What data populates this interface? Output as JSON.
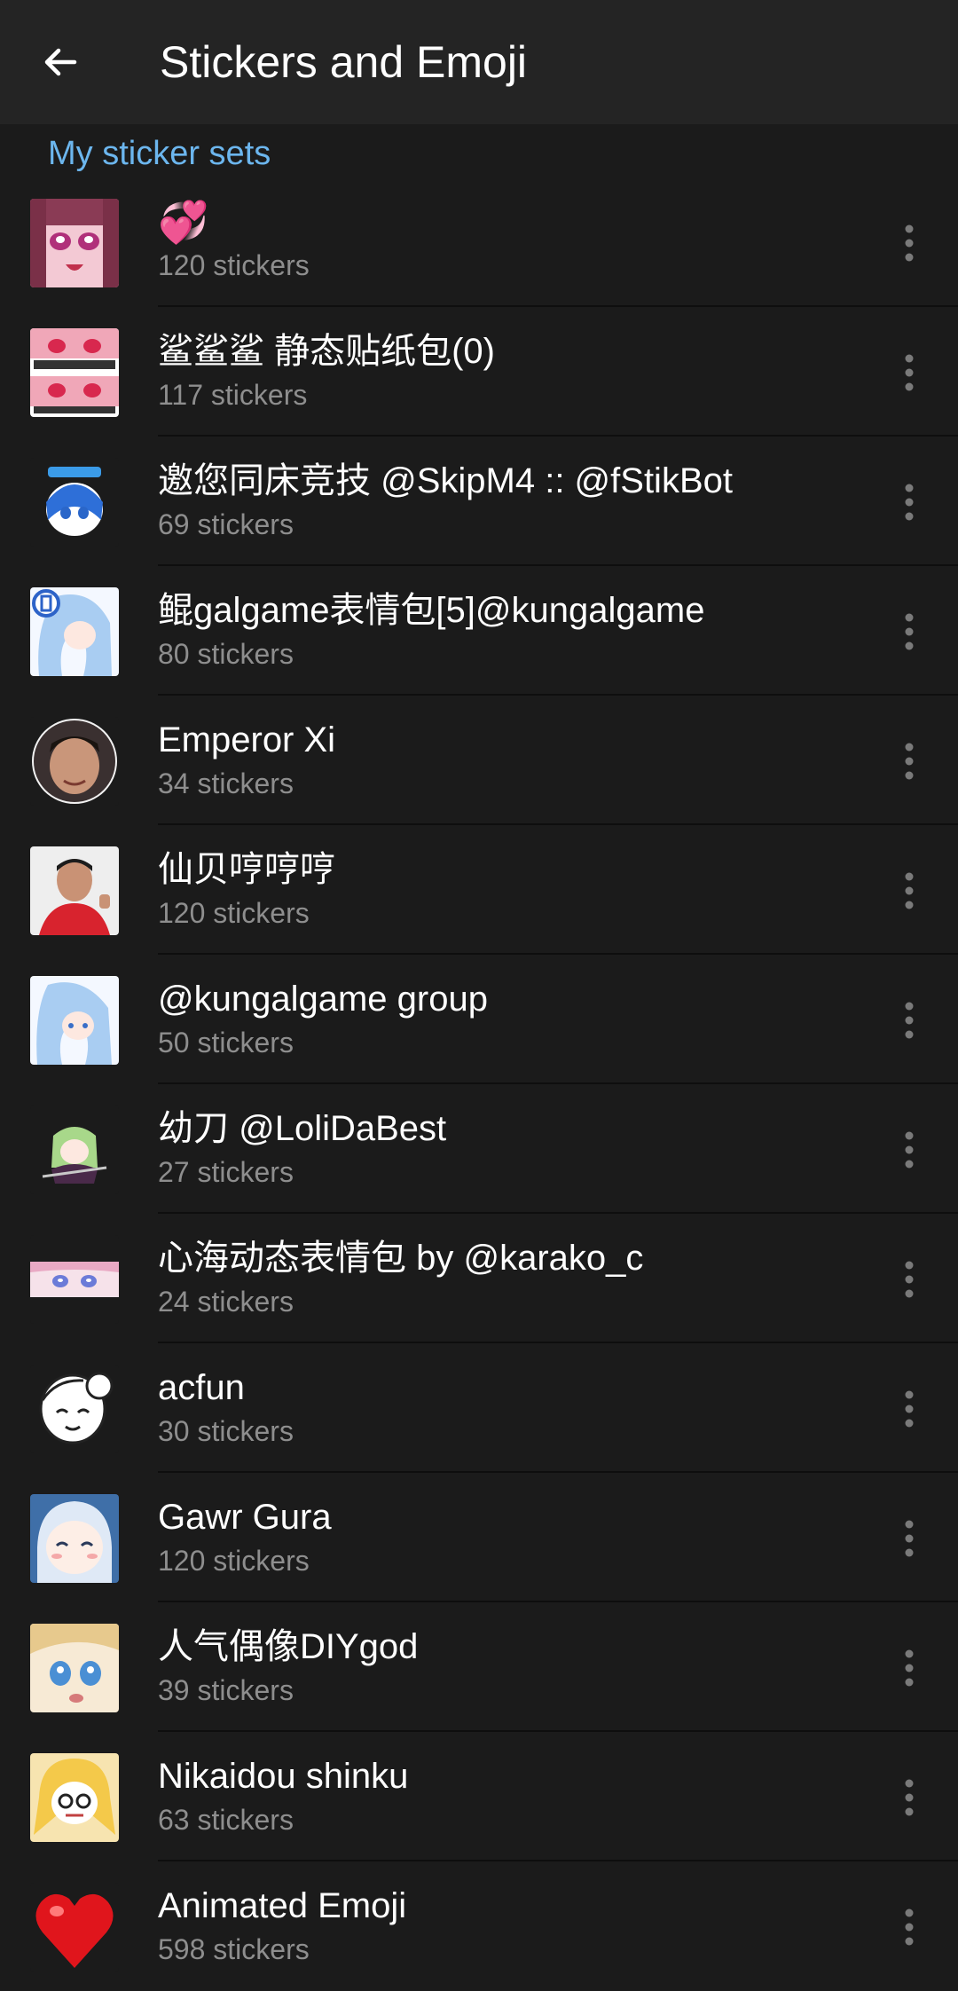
{
  "header": {
    "title": "Stickers and Emoji",
    "back_icon": "arrow-left-icon"
  },
  "section": {
    "title": "My sticker sets"
  },
  "sticker_sets": [
    {
      "name": "💞",
      "count": "120 stickers",
      "thumb": "anime-girl-pink"
    },
    {
      "name": "鲨鲨鲨 静态贴纸包(0)",
      "count": "117 stickers",
      "thumb": "pink-hair-meme"
    },
    {
      "name": "邀您同床竞技 @SkipM4 :: @fStikBot",
      "count": "69 stickers",
      "thumb": "blue-hair-chibi"
    },
    {
      "name": "鲲galgame表情包[5]@kungalgame",
      "count": "80 stickers",
      "thumb": "blue-hair-girl-5"
    },
    {
      "name": "Emperor Xi",
      "count": "34 stickers",
      "thumb": "portrait-circle"
    },
    {
      "name": "仙贝哼哼哼",
      "count": "120 stickers",
      "thumb": "man-red-shirt"
    },
    {
      "name": "@kungalgame group",
      "count": "50 stickers",
      "thumb": "blue-hair-girl"
    },
    {
      "name": "幼刀 @LoliDaBest",
      "count": "27 stickers",
      "thumb": "green-hair-girl"
    },
    {
      "name": "心海动态表情包 by @karako_c",
      "count": "24 stickers",
      "thumb": "pink-hair-eyes"
    },
    {
      "name": "acfun",
      "count": "30 stickers",
      "thumb": "lineart-girl"
    },
    {
      "name": "Gawr Gura",
      "count": "120 stickers",
      "thumb": "shark-girl"
    },
    {
      "name": "人气偶像DIYgod",
      "count": "39 stickers",
      "thumb": "blonde-face"
    },
    {
      "name": "Nikaidou shinku",
      "count": "63 stickers",
      "thumb": "yellow-hair-chibi"
    },
    {
      "name": "Animated Emoji",
      "count": "598 stickers",
      "thumb": "red-heart"
    }
  ],
  "colors": {
    "background": "#1b1b1b",
    "app_bar": "#242424",
    "accent": "#6cb6ee",
    "secondary_text": "#8e8e8e"
  }
}
